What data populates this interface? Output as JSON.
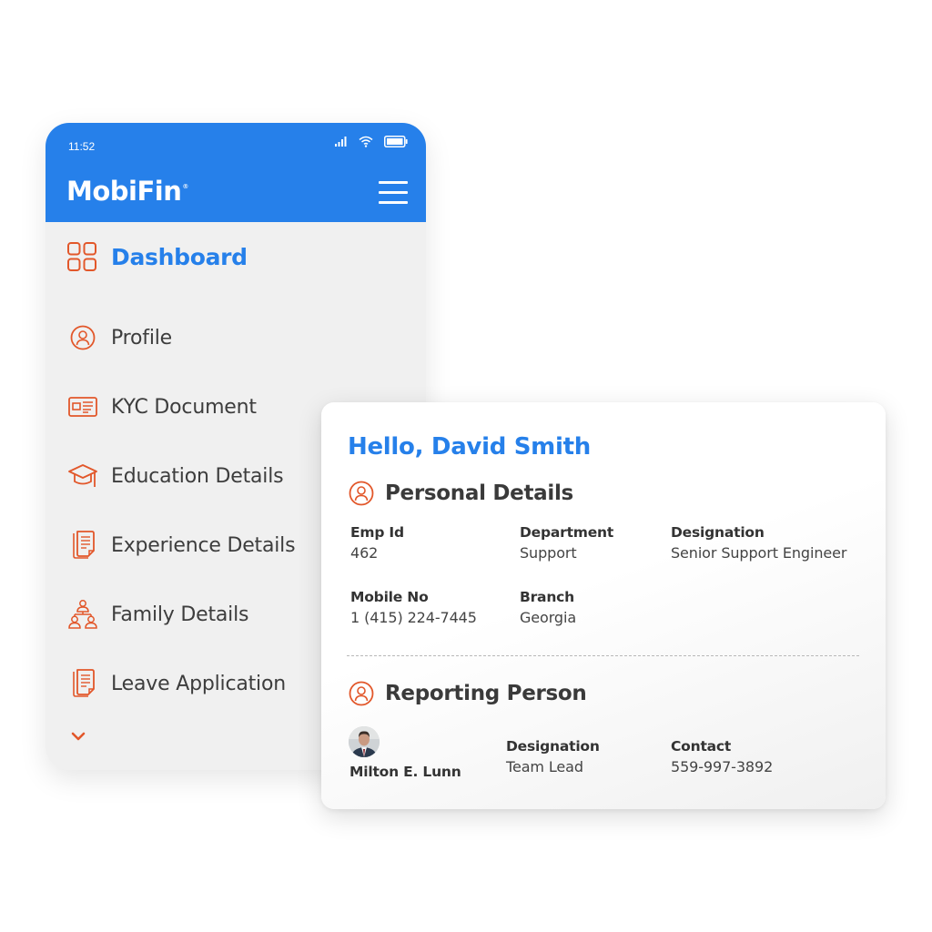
{
  "status_bar": {
    "time": "11:52",
    "icons": [
      "signal-icon",
      "wifi-icon",
      "battery-icon"
    ]
  },
  "app": {
    "brand": "MobiFin",
    "brand_mark": "®",
    "menu_icon": "hamburger-menu-icon"
  },
  "sidebar": {
    "active": {
      "label": "Dashboard",
      "icon": "grid-icon"
    },
    "items": [
      {
        "label": "Profile",
        "icon": "user-circle-icon"
      },
      {
        "label": "KYC Document",
        "icon": "id-card-icon"
      },
      {
        "label": "Education Details",
        "icon": "graduation-cap-icon"
      },
      {
        "label": "Experience Details",
        "icon": "documents-icon"
      },
      {
        "label": "Family Details",
        "icon": "family-tree-icon"
      },
      {
        "label": "Leave Application",
        "icon": "documents-icon"
      }
    ],
    "more_icon": "chevron-down-icon"
  },
  "card": {
    "greeting": "Hello, David Smith",
    "personal": {
      "title": "Personal Details",
      "fields": [
        {
          "label": "Emp Id",
          "value": "462"
        },
        {
          "label": "Department",
          "value": "Support"
        },
        {
          "label": "Designation",
          "value": "Senior Support Engineer"
        },
        {
          "label": "Mobile No",
          "value": "1 (415) 224-7445"
        },
        {
          "label": "Branch",
          "value": "Georgia"
        }
      ]
    },
    "reporting": {
      "title": "Reporting Person",
      "name": "Milton E. Lunn",
      "fields": [
        {
          "label": "Designation",
          "value": "Team Lead"
        },
        {
          "label": "Contact",
          "value": "559-997-3892"
        }
      ]
    }
  },
  "colors": {
    "primary": "#2680ea",
    "accent": "#e2572a",
    "background": "#f0f0f0",
    "text": "#3d3d3d"
  }
}
